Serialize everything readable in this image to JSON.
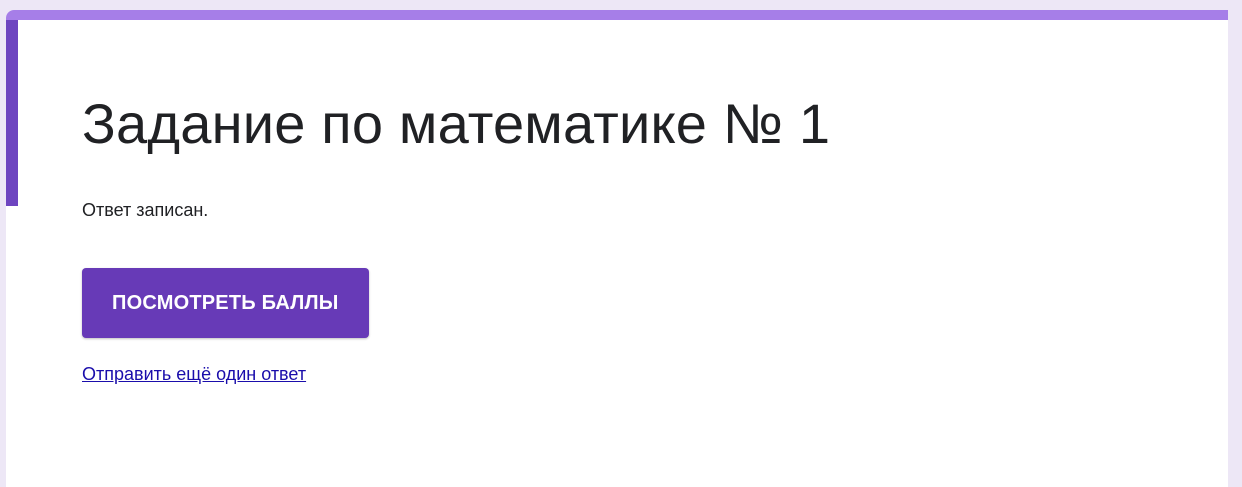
{
  "form": {
    "title": "Задание по математике № 1",
    "confirmation_message": "Ответ записан.",
    "view_score_label": "ПОСМОТРЕТЬ БАЛЛЫ",
    "submit_another_label": "Отправить ещё один ответ"
  },
  "colors": {
    "accent_top": "#a67ee8",
    "accent_left": "#6e45c0",
    "button": "#673ab7",
    "link": "#1a0dab",
    "background": "#ede7f6"
  }
}
